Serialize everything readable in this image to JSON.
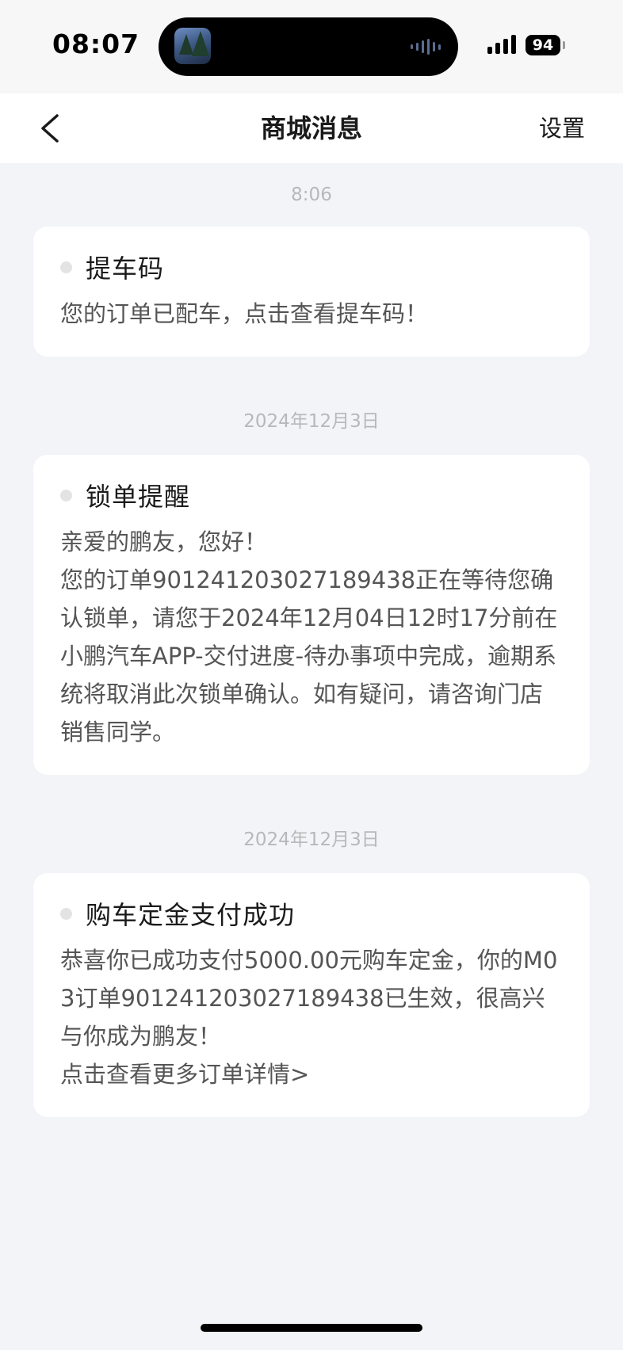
{
  "status_bar": {
    "time": "08:07",
    "battery_level": "94",
    "island_thumbnail_icon": "game-app-thumbnail-icon",
    "island_activity_icon": "audio-waveform-icon",
    "signal_icon": "cellular-signal-icon"
  },
  "nav": {
    "back_icon": "chevron-left-icon",
    "title": "商城消息",
    "settings_label": "设置"
  },
  "messages": [
    {
      "timestamp": "8:06",
      "title": "提车码",
      "body": "您的订单已配车，点击查看提车码！"
    },
    {
      "timestamp": "2024年12月3日",
      "title": "锁单提醒",
      "body": "亲爱的鹏友，您好！\n您的订单9012412030271894​38正在等待您确认锁单，请您于2024年12月04日12时17分前在小鹏汽车APP-交付进度-待办事项中完成，逾期系统将取消此次锁单确认。如有疑问，请咨询门店销售同学。"
    },
    {
      "timestamp": "2024年12月3日",
      "title": "购车定金支付成功",
      "body": "恭喜你已成功支付5000.00元购车定金，你的M03订单901241203027189438已生效，很高兴与你成为鹏友！\n点击查看更多订单详情>"
    }
  ],
  "colors": {
    "page_background": "#f3f4f8",
    "card_background": "#ffffff",
    "unread_dot": "#e3e3e3",
    "timestamp_text": "#b8b8b8",
    "body_text": "#555555"
  }
}
